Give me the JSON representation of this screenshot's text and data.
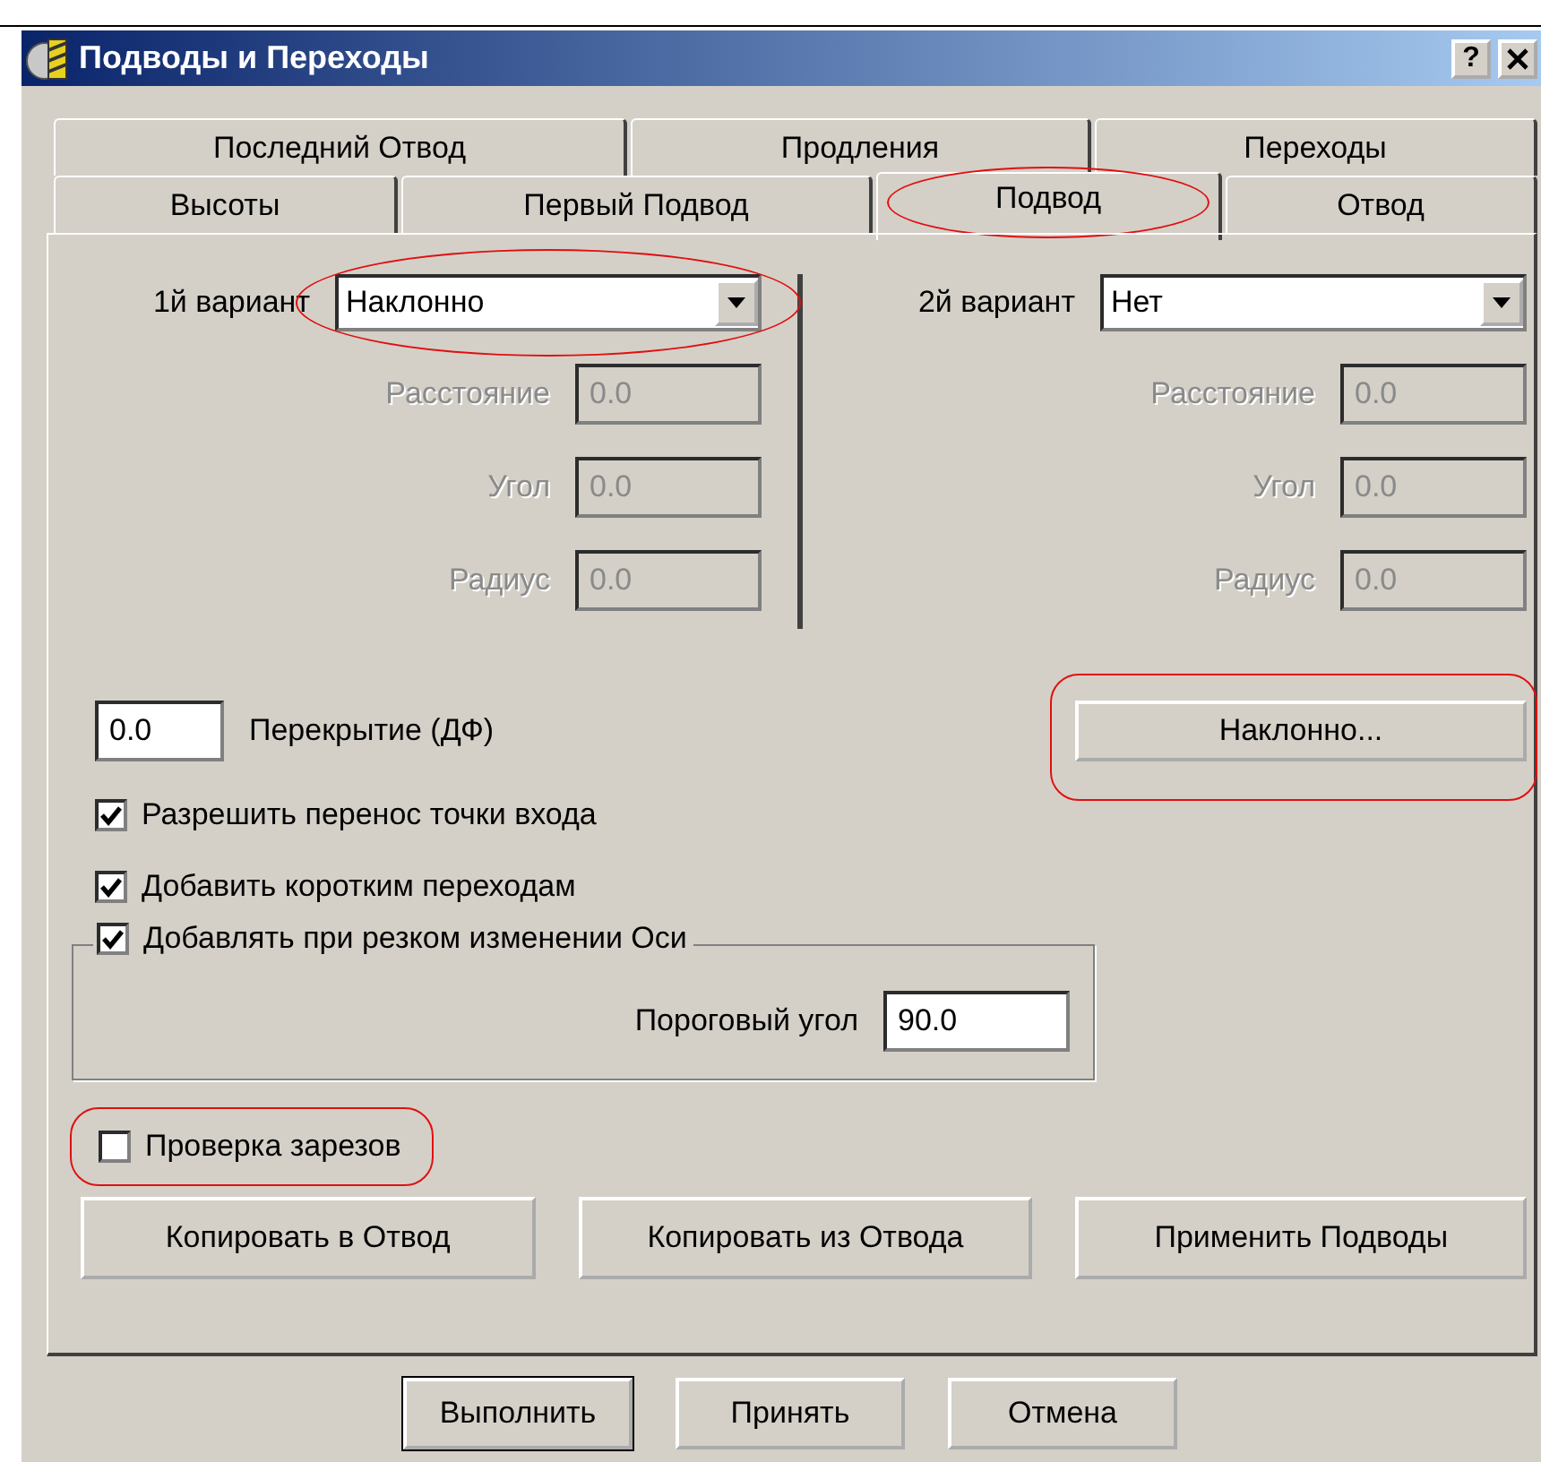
{
  "window": {
    "title": "Подводы и Переходы",
    "help_button": "?"
  },
  "tab_rows": [
    {
      "tabs": [
        {
          "label": "Последний Отвод",
          "selected": false,
          "circled": false
        },
        {
          "label": "Продления",
          "selected": false,
          "circled": false
        },
        {
          "label": "Переходы",
          "selected": false,
          "circled": false
        }
      ]
    },
    {
      "tabs": [
        {
          "label": "Высоты",
          "selected": false,
          "circled": false
        },
        {
          "label": "Первый Подвод",
          "selected": false,
          "circled": false
        },
        {
          "label": "Подвод",
          "selected": true,
          "circled": true
        },
        {
          "label": "Отвод",
          "selected": false,
          "circled": false
        }
      ]
    }
  ],
  "variants": [
    {
      "label": "1й вариант",
      "value": "Наклонно",
      "circled": true,
      "fields": [
        {
          "label": "Расстояние",
          "value": "0.0",
          "disabled": true
        },
        {
          "label": "Угол",
          "value": "0.0",
          "disabled": true
        },
        {
          "label": "Радиус",
          "value": "0.0",
          "disabled": true
        }
      ]
    },
    {
      "label": "2й вариант",
      "value": "Нет",
      "circled": false,
      "fields": [
        {
          "label": "Расстояние",
          "value": "0.0",
          "disabled": true
        },
        {
          "label": "Угол",
          "value": "0.0",
          "disabled": true
        },
        {
          "label": "Радиус",
          "value": "0.0",
          "disabled": true
        }
      ]
    }
  ],
  "overlap": {
    "value": "0.0",
    "label": "Перекрытие (ДФ)"
  },
  "settings_button": {
    "label": "Наклонно...",
    "circled": true
  },
  "options": [
    {
      "label": "Разрешить перенос точки входа",
      "checked": true
    },
    {
      "label": "Добавить коротким переходам",
      "checked": true
    }
  ],
  "axis_group": {
    "label": "Добавлять при резком изменении Оси",
    "checked": true,
    "threshold_label": "Пороговый угол",
    "threshold_value": "90.0"
  },
  "gouge_check": {
    "label": "Проверка зарезов",
    "checked": false,
    "circled": true
  },
  "copy_buttons": [
    {
      "label": "Копировать в Отвод"
    },
    {
      "label": "Копировать из Отвода"
    },
    {
      "label": "Применить Подводы"
    }
  ],
  "footer_buttons": [
    {
      "label": "Выполнить",
      "default": true
    },
    {
      "label": "Принять",
      "default": false
    },
    {
      "label": "Отмена",
      "default": false
    }
  ]
}
